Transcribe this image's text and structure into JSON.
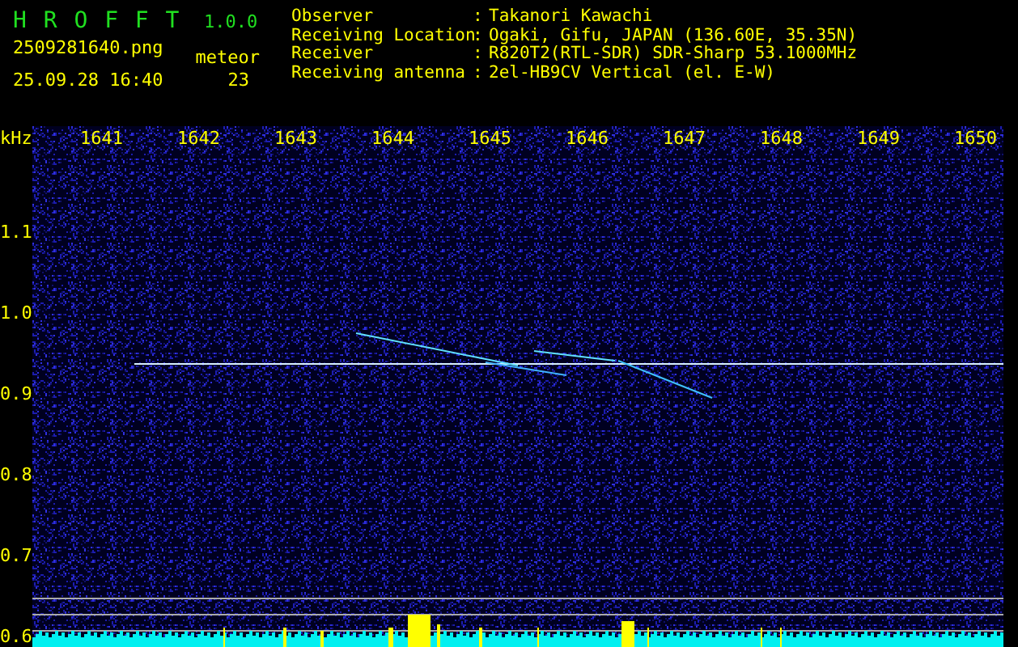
{
  "app": {
    "name": "H R O F F T",
    "version": "1.0.0",
    "file": "2509281640.png",
    "datetime": "25.09.28 16:40",
    "meteor_label": "meteor",
    "meteor_count": "23"
  },
  "info": [
    {
      "label": "Observer",
      "separator": ":",
      "value": "Takanori Kawachi"
    },
    {
      "label": "Receiving Location",
      "separator": ":",
      "value": "Ogaki, Gifu, JAPAN (136.60E, 35.35N)"
    },
    {
      "label": "Receiver",
      "separator": ":",
      "value": "R820T2(RTL-SDR) SDR-Sharp 53.1000MHz"
    },
    {
      "label": "Receiving antenna",
      "separator": ":",
      "value": "2el-HB9CV Vertical (el. E-W)"
    }
  ],
  "plot": {
    "y_unit": "kHz",
    "x_labels": [
      "1641",
      "1642",
      "1643",
      "1644",
      "1645",
      "1646",
      "1647",
      "1648",
      "1649",
      "1650"
    ],
    "y_labels": [
      "1.1",
      "1.0",
      "0.9",
      "0.8",
      "0.7",
      "0.6"
    ]
  }
}
